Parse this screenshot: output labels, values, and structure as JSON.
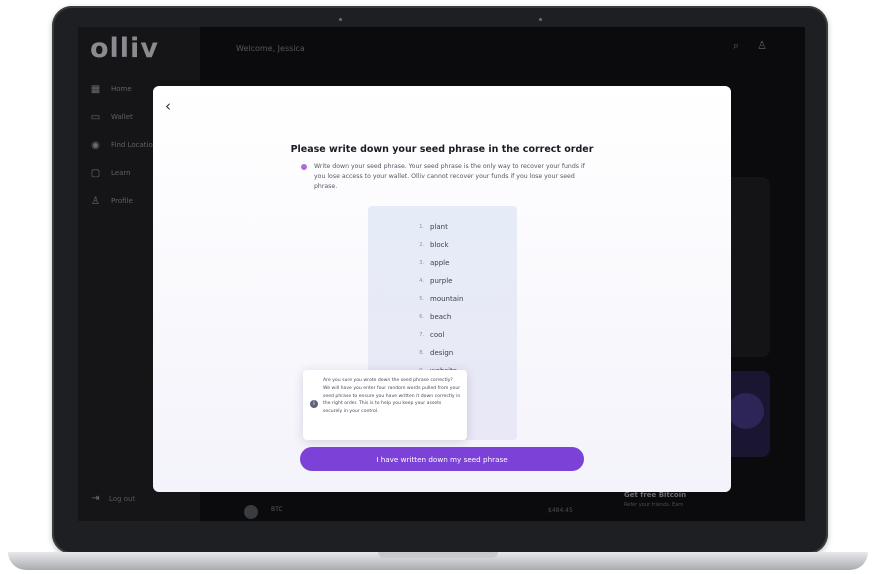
{
  "app": {
    "brand": "olliv",
    "welcome": "Welcome, Jessica",
    "sidebar": {
      "items": [
        {
          "label": "Home",
          "icon": "grid-icon"
        },
        {
          "label": "Wallet",
          "icon": "wallet-icon"
        },
        {
          "label": "Find Locations",
          "icon": "location-icon"
        },
        {
          "label": "Learn",
          "icon": "book-icon"
        },
        {
          "label": "Profile",
          "icon": "user-icon"
        }
      ],
      "logout": "Log out"
    },
    "promo": {
      "title": "Get free Bitcoin",
      "subtitle": "Refer your friends. Earn"
    },
    "asset_row": {
      "ticker": "BTC",
      "amount": "$484.45"
    }
  },
  "modal": {
    "title": "Please write down your seed phrase in the correct order",
    "description": "Write down your seed phrase. Your seed phrase is the only way to recover your funds if you lose access to your wallet. Olliv cannot recover your funds if you lose your seed phrase.",
    "seed_words": [
      "plant",
      "block",
      "apple",
      "purple",
      "mountain",
      "beach",
      "cool",
      "design",
      "website"
    ],
    "popup_text": "Are you sure you wrote down the seed phrase correctly? We will have you enter four random words pulled from your seed phrase to ensure you have written it down correctly in the right order. This is to help you keep your assets securely in your control.",
    "confirm_button": "I have written down my seed phrase"
  },
  "colors": {
    "accent": "#7c41d6",
    "info_dot": "#b16bd9"
  }
}
